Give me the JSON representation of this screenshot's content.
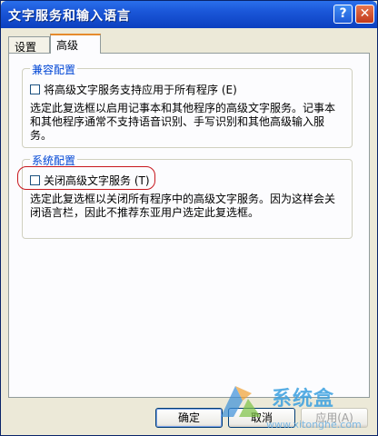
{
  "window": {
    "title": "文字服务和输入语言"
  },
  "titlebar": {
    "help_glyph": "?",
    "close_glyph": "✕"
  },
  "tabs": [
    {
      "label": "设置",
      "active": false
    },
    {
      "label": "高级",
      "active": true
    }
  ],
  "compat_group": {
    "title": "兼容配置",
    "checkbox_label": "将高级文字服务支持应用于所有程序 (E)",
    "checked": false,
    "description": "选定此复选框以启用记事本和其他程序的高级文字服务。记事本和其他程序通常不支持语音识别、手写识别和其他高级输入服务。"
  },
  "system_group": {
    "title": "系统配置",
    "checkbox_label": "关闭高级文字服务 (T)",
    "checked": false,
    "description": "选定此复选框以关闭所有程序中的高级文字服务。因为这样会关闭语言栏，因此不推荐东亚用户选定此复选框。"
  },
  "buttons": {
    "ok": "确定",
    "cancel": "取消",
    "apply": "应用(A)"
  },
  "watermark": {
    "title": "系统盒",
    "url": "www.xitonghe.com"
  },
  "colors": {
    "accent": "#0046D5",
    "highlight": "#C8181E",
    "titlebar": "#0C40C0"
  }
}
